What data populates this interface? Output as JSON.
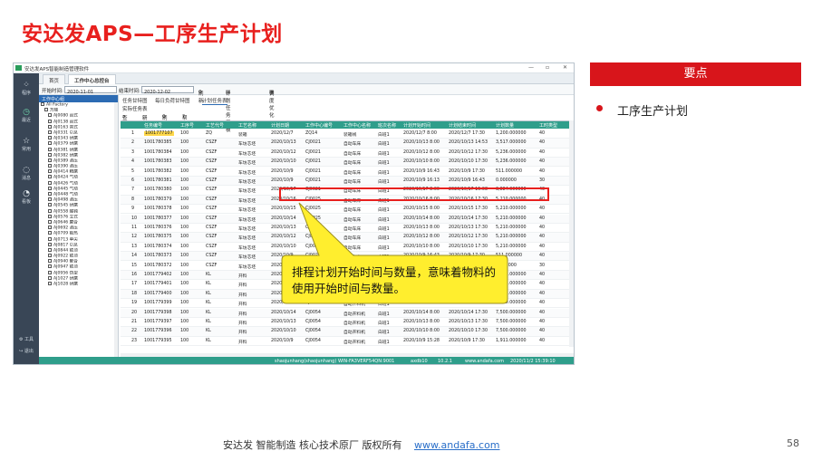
{
  "slide": {
    "title": "安达发APS—工序生产计划",
    "panel_title": "要点",
    "bullet": "工序生产计划",
    "callout": "排程计划开始时间与数量，意味着物料的使用开始时间与数量。",
    "footer_text": "安达发  智能制造 核心技术原厂   版权所有",
    "footer_link": "www.andafa.com",
    "page_number": "58"
  },
  "app": {
    "window_title": "安达发APS智能制造管理软件",
    "window_controls": [
      "—",
      "▫",
      "✕"
    ],
    "left_nav": [
      "程序",
      "最近",
      "常用",
      "消息",
      "看板",
      "工具",
      "退出"
    ],
    "tabs": [
      "首页",
      "工作中心总控台"
    ],
    "filter": {
      "start_label": "开始时间:",
      "start_value": "2020-11-01",
      "end_label": "结束时间:",
      "end_value": "2020-12-02",
      "refresh": "刷新",
      "plan_task": "计划任务甲板",
      "unschedule": "调度优化"
    },
    "tree": {
      "header": "工作中心组",
      "root": "All Factory",
      "node": "万顺",
      "items": [
        "All Factory",
        "万顺",
        "AJ0080 台式",
        "AJ0138 台式",
        "AJ0163 普式",
        "AJ0331 引息",
        "AJ0343 研磨",
        "AJ0379 研磨",
        "AJ0381 研磨",
        "AJ0382 研磨",
        "AJ0389 酒压",
        "AJ0390 酒压",
        "AJ0414 精磨",
        "AJ0424 气动",
        "AJ0426 气动",
        "AJ0445 气动",
        "AJ0448 气动",
        "AJ0498 酒压",
        "AJ0545 研磨",
        "AJ0558 酸钝",
        "AJ0576 立式",
        "AJ0646 磨合",
        "AJ0692 酒压",
        "AJ0709 锻热",
        "AJ0713 单尖",
        "AJ0817 引息",
        "AJ0844 锁顶",
        "AJ0922 锁顶",
        "AJ0940 聚合",
        "AJ0947 锁顶",
        "AJ0956 伪型",
        "AJ1027 研磨",
        "AJ1028 研磨"
      ],
      "search_button": "查找"
    },
    "subtabs": [
      "任务甘特图",
      "每日负荷甘特图",
      "计划任务表"
    ],
    "subtab2": "实际任务表",
    "toolbar": [
      "查找",
      "新建",
      "刷新",
      "帮助"
    ],
    "columns": [
      "任务编号",
      "工序号",
      "工艺代号",
      "工艺名称",
      "计划日期",
      "工作中心编号",
      "工作中心名称",
      "班次名称",
      "计划开始时间",
      "计划结束时间",
      "计划数量",
      "工时类型"
    ],
    "rows": [
      [
        "1001777107",
        "100",
        "ZQ",
        "装箱",
        "2020/12/7",
        "ZQ14",
        "装箱线",
        "白班1",
        "2020/12/7 8:00",
        "2020/12/7 17:30",
        "1,200.000000",
        "40"
      ],
      [
        "1001780385",
        "100",
        "CSZF",
        "车坊芯坯",
        "2020/10/13",
        "CJ0021",
        "自动车床",
        "白班1",
        "2020/10/13 8:00",
        "2020/10/13 14:53",
        "3,517.000000",
        "40"
      ],
      [
        "1001780384",
        "100",
        "CSZF",
        "车坊芯坯",
        "2020/10/12",
        "CJ0021",
        "自动车床",
        "白班1",
        "2020/10/12 8:00",
        "2020/10/12 17:30",
        "5,236.000000",
        "40"
      ],
      [
        "1001780383",
        "100",
        "CSZF",
        "车坊芯坯",
        "2020/10/10",
        "CJ0021",
        "自动车床",
        "白班1",
        "2020/10/10 8:00",
        "2020/10/10 17:30",
        "5,236.000000",
        "40"
      ],
      [
        "1001780382",
        "100",
        "CSZF",
        "车坊芯坯",
        "2020/10/9",
        "CJ0021",
        "自动车床",
        "白班1",
        "2020/10/9 16:43",
        "2020/10/9 17:30",
        "511.000000",
        "40"
      ],
      [
        "1001780381",
        "100",
        "CSZF",
        "车坊芯坯",
        "2020/10/9",
        "CJ0021",
        "自动车床",
        "白班1",
        "2020/10/9 16:13",
        "2020/10/9 16:43",
        "0.000000",
        "30"
      ],
      [
        "1001780380",
        "100",
        "CSZF",
        "车坊芯坯",
        "2020/10/17",
        "CJ0021",
        "自动车床",
        "白班1",
        "2020/10/17 8:00",
        "2020/10/17 15:08",
        "3,884.000000",
        "40"
      ],
      [
        "1001780379",
        "100",
        "CSZF",
        "车坊芯坯",
        "2020/10/16",
        "CJ0025",
        "自动车床",
        "白班1",
        "2020/10/16 8:00",
        "2020/10/16 17:30",
        "5,210.000000",
        "40"
      ],
      [
        "1001780378",
        "100",
        "CSZF",
        "车坊芯坯",
        "2020/10/15",
        "CJ0025",
        "自动车床",
        "白班1",
        "2020/10/15 8:00",
        "2020/10/15 17:30",
        "5,210.000000",
        "40"
      ],
      [
        "1001780377",
        "100",
        "CSZF",
        "车坊芯坯",
        "2020/10/14",
        "CJ0025",
        "自动车床",
        "白班1",
        "2020/10/14 8:00",
        "2020/10/14 17:30",
        "5,210.000000",
        "40"
      ],
      [
        "1001780376",
        "100",
        "CSZF",
        "车坊芯坯",
        "2020/10/13",
        "CJ0025",
        "自动车床",
        "白班1",
        "2020/10/13 8:00",
        "2020/10/13 17:30",
        "5,210.000000",
        "40"
      ],
      [
        "1001780375",
        "100",
        "CSZF",
        "车坊芯坯",
        "2020/10/12",
        "CJ0025",
        "自动车床",
        "白班1",
        "2020/10/12 8:00",
        "2020/10/12 17:30",
        "5,210.000000",
        "40"
      ],
      [
        "1001780374",
        "100",
        "CSZF",
        "车坊芯坯",
        "2020/10/10",
        "CJ0025",
        "自动车床",
        "白班1",
        "2020/10/10 8:00",
        "2020/10/10 17:30",
        "5,210.000000",
        "40"
      ],
      [
        "1001780373",
        "100",
        "CSZF",
        "车坊芯坯",
        "2020/10/9",
        "CJ0025",
        "自动车床",
        "白班1",
        "2020/10/9 16:43",
        "2020/10/9 17:30",
        "511.000000",
        "40"
      ],
      [
        "1001780372",
        "100",
        "CSZF",
        "车坊芯坯",
        "2020/10/9",
        "CJ0025",
        "自动车床",
        "白班1",
        "2020/10/9 16:13",
        "2020/10/9 16:43",
        "0.000000",
        "30"
      ],
      [
        "1001779402",
        "100",
        "KL",
        "开料",
        "2020/10/13",
        "CJ0054",
        "自动开料机",
        "白班1",
        "2020/10/13 8:00",
        "2020/10/13 17:30",
        "7,500.000000",
        "40"
      ],
      [
        "1001779401",
        "100",
        "KL",
        "开料",
        "2020/10/12",
        "CJ0054",
        "自动开料机",
        "白班1",
        "2020/10/12 8:00",
        "2020/10/12 17:30",
        "7,500.000000",
        "40"
      ],
      [
        "1001779400",
        "100",
        "KL",
        "开料",
        "2020/10/10",
        "CJ0054",
        "自动开料机",
        "白班1",
        "2020/10/10 8:00",
        "2020/10/10 17:30",
        "7,500.000000",
        "40"
      ],
      [
        "1001779399",
        "100",
        "KL",
        "开料",
        "2020/10/9",
        "CJ0054",
        "自动开料机",
        "白班1",
        "2020/10/9 8:00",
        "2020/10/9 17:30",
        "7,500.000000",
        "40"
      ],
      [
        "1001779398",
        "100",
        "KL",
        "开料",
        "2020/10/14",
        "CJ0054",
        "自动开料机",
        "白班1",
        "2020/10/14 8:00",
        "2020/10/14 17:30",
        "7,500.000000",
        "40"
      ],
      [
        "1001779397",
        "100",
        "KL",
        "开料",
        "2020/10/13",
        "CJ0054",
        "自动开料机",
        "白班1",
        "2020/10/13 8:00",
        "2020/10/13 17:30",
        "7,500.000000",
        "40"
      ],
      [
        "1001779396",
        "100",
        "KL",
        "开料",
        "2020/10/10",
        "CJ0054",
        "自动开料机",
        "白班1",
        "2020/10/10 8:00",
        "2020/10/10 17:30",
        "7,500.000000",
        "40"
      ],
      [
        "1001779395",
        "100",
        "KL",
        "开料",
        "2020/10/9",
        "CJ0054",
        "自动开料机",
        "白班1",
        "2020/10/9 15:28",
        "2020/10/9 17:30",
        "1,911.000000",
        "40"
      ]
    ],
    "status": {
      "user": "shaojunhang(shaojunhang)",
      "server": "WIN-FA3VERF54QN:9001",
      "db": "axdb10",
      "ip": "10.2.1",
      "site": "www.andafa.com",
      "time": "2020/11/2 15:39:10"
    }
  }
}
